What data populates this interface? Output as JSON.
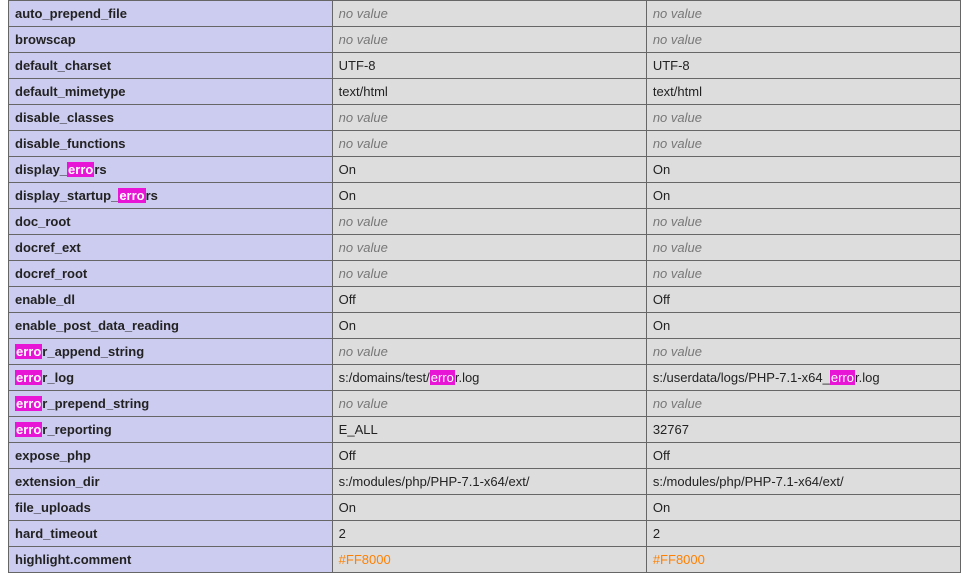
{
  "no_value_label": "no value",
  "highlight_token": "erro",
  "rows": [
    {
      "directive": "auto_prepend_file",
      "local": "no value",
      "master": "no value"
    },
    {
      "directive": "browscap",
      "local": "no value",
      "master": "no value"
    },
    {
      "directive": "default_charset",
      "local": "UTF-8",
      "master": "UTF-8"
    },
    {
      "directive": "default_mimetype",
      "local": "text/html",
      "master": "text/html"
    },
    {
      "directive": "disable_classes",
      "local": "no value",
      "master": "no value"
    },
    {
      "directive": "disable_functions",
      "local": "no value",
      "master": "no value"
    },
    {
      "directive": "display_errors",
      "local": "On",
      "master": "On"
    },
    {
      "directive": "display_startup_errors",
      "local": "On",
      "master": "On"
    },
    {
      "directive": "doc_root",
      "local": "no value",
      "master": "no value"
    },
    {
      "directive": "docref_ext",
      "local": "no value",
      "master": "no value"
    },
    {
      "directive": "docref_root",
      "local": "no value",
      "master": "no value"
    },
    {
      "directive": "enable_dl",
      "local": "Off",
      "master": "Off"
    },
    {
      "directive": "enable_post_data_reading",
      "local": "On",
      "master": "On"
    },
    {
      "directive": "error_append_string",
      "local": "no value",
      "master": "no value"
    },
    {
      "directive": "error_log",
      "local": "s:/domains/test/error.log",
      "master": "s:/userdata/logs/PHP-7.1-x64_error.log"
    },
    {
      "directive": "error_prepend_string",
      "local": "no value",
      "master": "no value"
    },
    {
      "directive": "error_reporting",
      "local": "E_ALL",
      "master": "32767"
    },
    {
      "directive": "expose_php",
      "local": "Off",
      "master": "Off"
    },
    {
      "directive": "extension_dir",
      "local": "s:/modules/php/PHP-7.1-x64/ext/",
      "master": "s:/modules/php/PHP-7.1-x64/ext/"
    },
    {
      "directive": "file_uploads",
      "local": "On",
      "master": "On"
    },
    {
      "directive": "hard_timeout",
      "local": "2",
      "master": "2"
    },
    {
      "directive": "highlight.comment",
      "local": "#FF8000",
      "master": "#FF8000",
      "is_color": true
    }
  ]
}
